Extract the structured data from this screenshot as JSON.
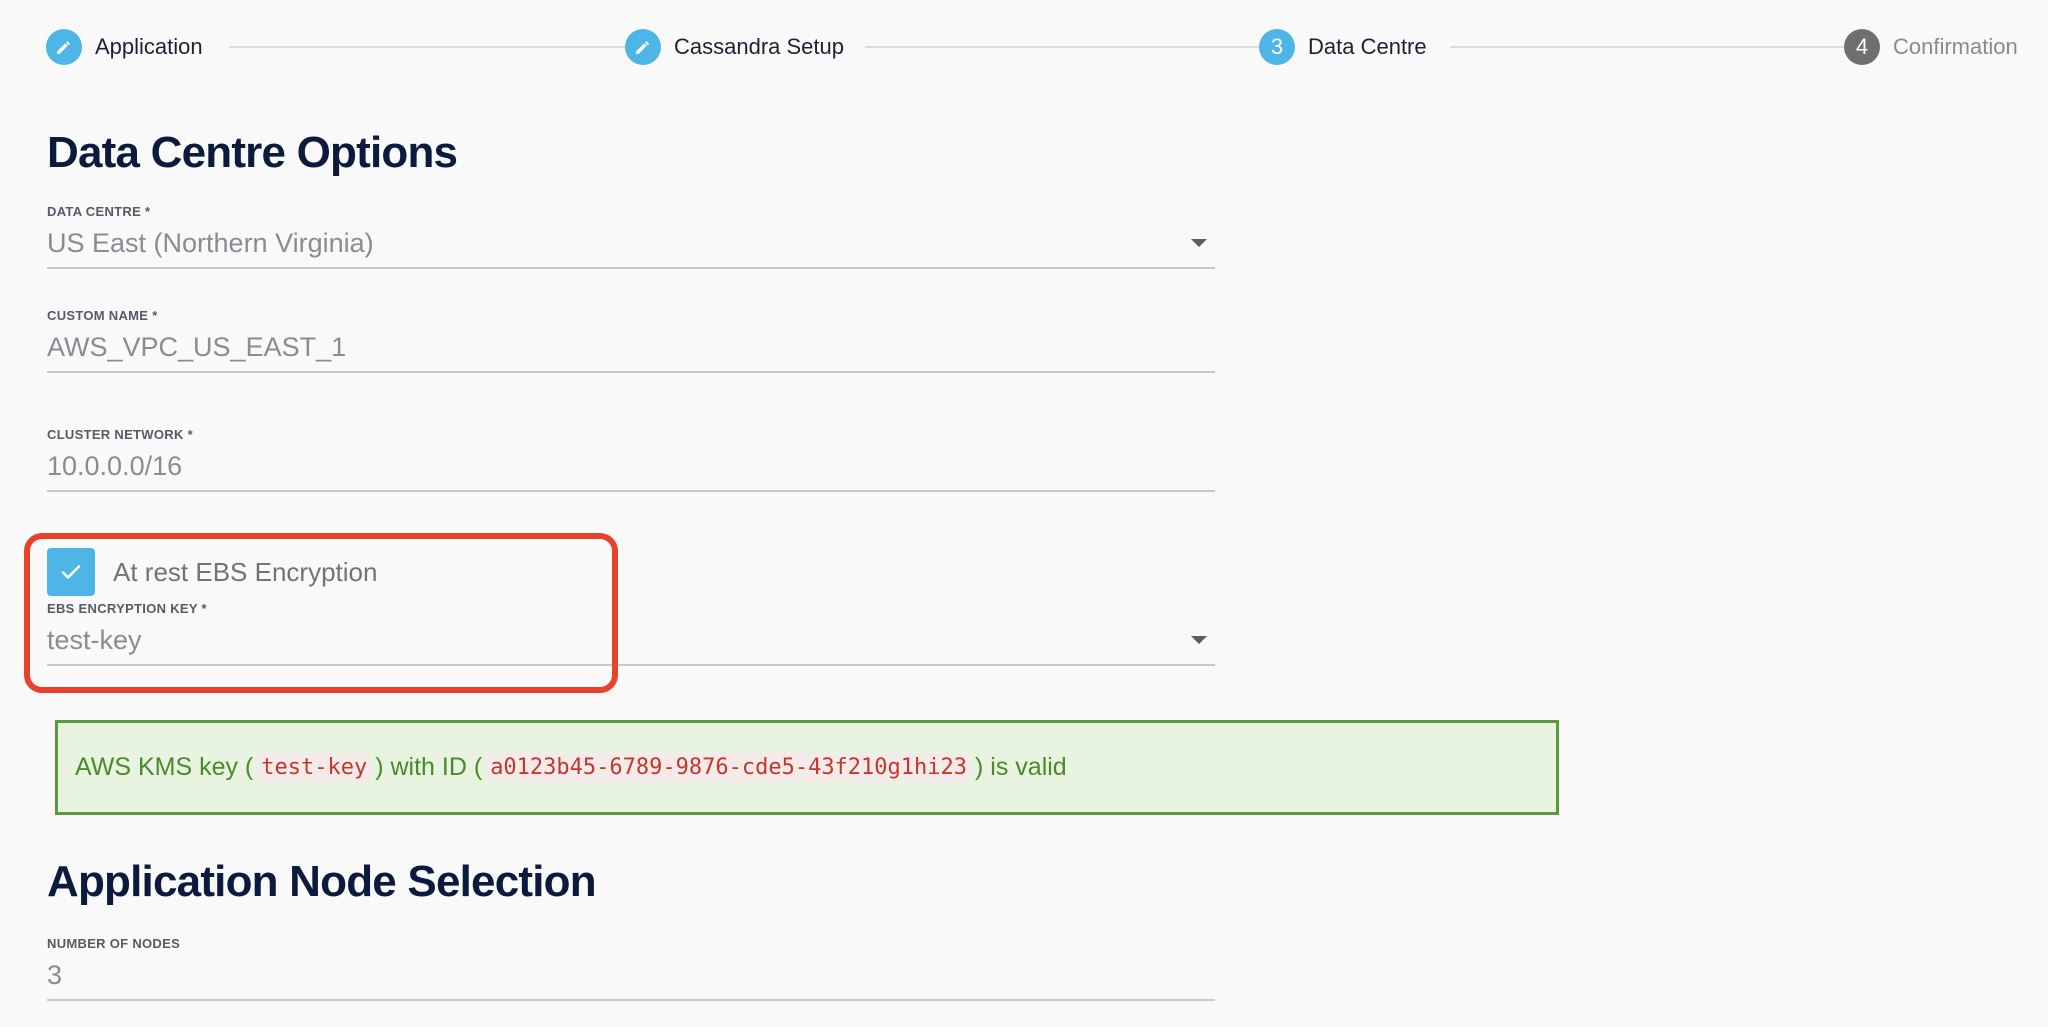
{
  "stepper": {
    "steps": [
      {
        "label": "Application",
        "marker": "pencil-icon",
        "state": "done"
      },
      {
        "label": "Cassandra Setup",
        "marker": "pencil-icon",
        "state": "done"
      },
      {
        "label": "Data Centre",
        "number": "3",
        "state": "active"
      },
      {
        "label": "Confirmation",
        "number": "4",
        "state": "todo"
      }
    ]
  },
  "data_centre_section": {
    "title": "Data Centre Options",
    "data_centre": {
      "label": "DATA CENTRE *",
      "value": "US East (Northern Virginia)"
    },
    "custom_name": {
      "label": "CUSTOM NAME *",
      "value": "AWS_VPC_US_EAST_1"
    },
    "cluster_network": {
      "label": "CLUSTER NETWORK *",
      "value": "10.0.0.0/16"
    },
    "ebs_encryption": {
      "label": "At rest EBS Encryption",
      "checked": true
    },
    "ebs_key": {
      "label": "EBS ENCRYPTION KEY *",
      "value": "test-key"
    }
  },
  "validation": {
    "prefix": "AWS KMS key (",
    "key_name": "test-key",
    "middle": ") with ID (",
    "key_id": "a0123b45-6789-9876-cde5-43f210g1hi23",
    "suffix": ") is valid"
  },
  "node_section": {
    "title": "Application Node Selection",
    "number_of_nodes": {
      "label": "NUMBER OF NODES",
      "value": "3"
    }
  },
  "colors": {
    "accent": "#4db6e6",
    "heading": "#0b1a3d",
    "highlight": "#e8422c",
    "success_bg": "#e8f4e0",
    "success_border": "#5b9a3a"
  }
}
